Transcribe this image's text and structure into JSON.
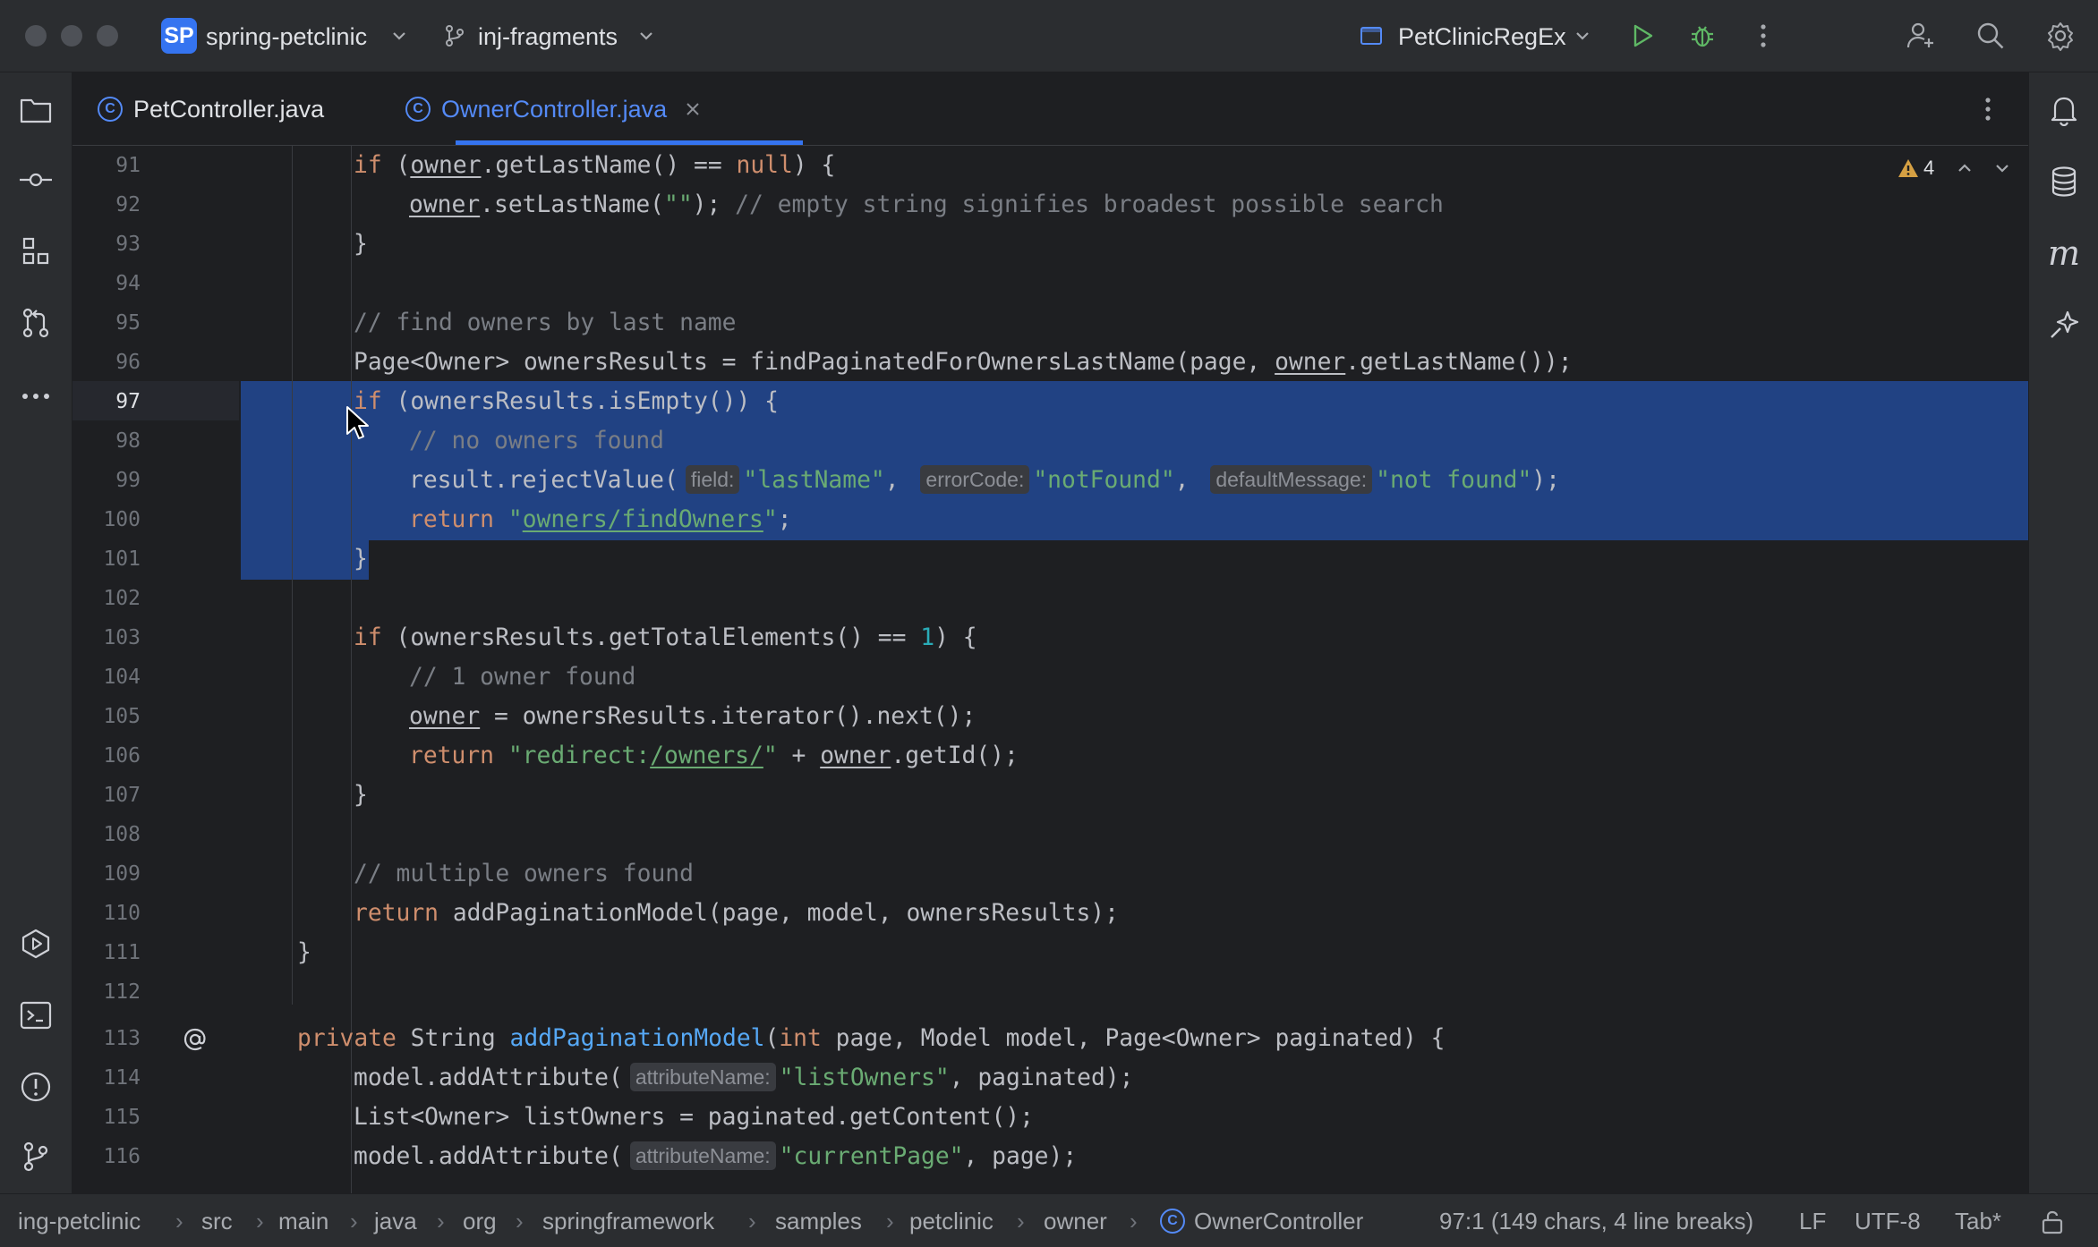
{
  "titlebar": {
    "project_badge": "SP",
    "project_name": "spring-petclinic",
    "branch": "inj-fragments",
    "run_config": "PetClinicRegEx"
  },
  "tabs": [
    {
      "label": "PetController.java"
    },
    {
      "label": "OwnerController.java"
    }
  ],
  "editor": {
    "warnings_count": "4",
    "lines": [
      {
        "n": "91"
      },
      {
        "n": "92"
      },
      {
        "n": "93"
      },
      {
        "n": "94"
      },
      {
        "n": "95"
      },
      {
        "n": "96"
      },
      {
        "n": "97"
      },
      {
        "n": "98"
      },
      {
        "n": "99"
      },
      {
        "n": "100"
      },
      {
        "n": "101"
      },
      {
        "n": "102"
      },
      {
        "n": "103"
      },
      {
        "n": "104"
      },
      {
        "n": "105"
      },
      {
        "n": "106"
      },
      {
        "n": "107"
      },
      {
        "n": "108"
      },
      {
        "n": "109"
      },
      {
        "n": "110"
      },
      {
        "n": "111"
      },
      {
        "n": "112"
      },
      {
        "n": "113"
      },
      {
        "n": "114"
      },
      {
        "n": "115"
      },
      {
        "n": "116"
      }
    ],
    "code": {
      "l91": [
        "if",
        " (",
        "owner",
        ".getLastName() == ",
        "null",
        ") {"
      ],
      "l92": [
        "owner",
        ".setLastName(",
        "\"\"",
        "); ",
        "// empty string signifies broadest possible search"
      ],
      "l93": "}",
      "l95": "// find owners by last name",
      "l96": [
        "Page<Owner> ownersResults = findPaginatedForOwnersLastName(page, ",
        "owner",
        ".getLastName());"
      ],
      "l97": [
        "if",
        " (ownersResults.isEmpty()) {"
      ],
      "l98": "// no owners found",
      "l99": [
        "result.rejectValue(",
        "field:",
        "\"lastName\"",
        ", ",
        "errorCode:",
        "\"notFound\"",
        ", ",
        "defaultMessage:",
        "\"not found\"",
        ");"
      ],
      "l100": [
        "return",
        " ",
        "\"",
        "owners/findOwners",
        "\"",
        ";"
      ],
      "l101": "}",
      "l103": [
        "if",
        " (ownersResults.getTotalElements() == ",
        "1",
        ") {"
      ],
      "l104": "// 1 owner found",
      "l105": [
        "owner",
        " = ownersResults.iterator().next();"
      ],
      "l106": [
        "return",
        " ",
        "\"redirect:",
        "/owners/",
        "\"",
        " + ",
        "owner",
        ".getId();"
      ],
      "l107": "}",
      "l109": "// multiple owners found",
      "l110": [
        "return",
        " addPaginationModel(page, model, ownersResults);"
      ],
      "l111": "}",
      "l113": [
        "private",
        " String ",
        "addPaginationModel",
        "(",
        "int",
        " page, Model model, Page<Owner> paginated) {"
      ],
      "l114": [
        "model.addAttribute(",
        "attributeName:",
        "\"listOwners\"",
        ", paginated);"
      ],
      "l115": "List<Owner> listOwners = paginated.getContent();",
      "l116": [
        "model.addAttribute(",
        "attributeName:",
        "\"currentPage\"",
        ", page);"
      ]
    }
  },
  "statusbar": {
    "breadcrumbs": [
      "ing-petclinic",
      "src",
      "main",
      "java",
      "org",
      "springframework",
      "samples",
      "petclinic",
      "owner",
      "OwnerController"
    ],
    "position": "97:1 (149 chars, 4 line breaks)",
    "line_separator": "LF",
    "encoding": "UTF-8",
    "indent": "Tab*"
  },
  "colors": {
    "accent": "#3574f0",
    "selection": "#214283",
    "keyword": "#cf8e6d",
    "string": "#6aab73",
    "comment": "#7a7e85",
    "number": "#2aacb8",
    "method": "#56a8f5",
    "run_green": "#5fb865"
  },
  "icons": {
    "left": [
      "folder-icon",
      "commit-icon",
      "structure-icon",
      "pull-requests-icon",
      "more-icon",
      "services-icon",
      "terminal-icon",
      "problems-icon",
      "git-icon"
    ],
    "right": [
      "notifications-icon",
      "database-icon",
      "maven-icon",
      "ai-assistant-icon"
    ],
    "titlebar": [
      "run-icon",
      "debug-icon",
      "more-vertical-icon",
      "add-user-icon",
      "search-icon",
      "settings-icon"
    ]
  }
}
